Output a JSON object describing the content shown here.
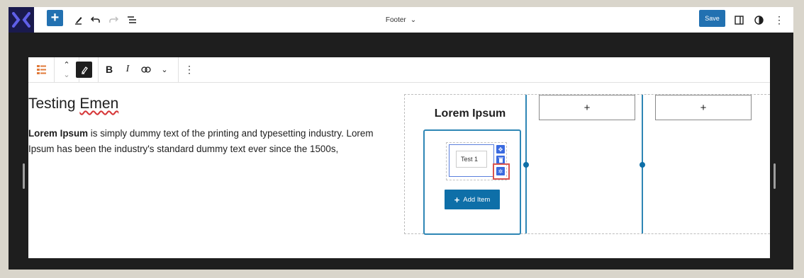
{
  "colors": {
    "accent": "#2271b1",
    "column_border": "#2e86b5",
    "add_item_button": "#0e6fa8",
    "highlight": "#d9534f",
    "logo_bg": "#1a1a4e",
    "logo_fg": "#5f5fe8"
  },
  "topbar": {
    "template_title": "Footer",
    "save_label": "Save",
    "icons": [
      "logo-icon",
      "plus-icon",
      "pencil-icon",
      "undo-icon",
      "redo-icon",
      "list-view-icon",
      "chevron-down-icon",
      "sidebar-toggle-icon",
      "styles-icon",
      "options-icon"
    ]
  },
  "block_toolbar": {
    "icons": [
      "list-block-icon",
      "move-up-icon",
      "move-down-icon",
      "highlight-icon",
      "bold-icon",
      "italic-icon",
      "link-icon",
      "more-rich-text-icon",
      "block-options-icon"
    ],
    "bold": "B",
    "italic": "I"
  },
  "content": {
    "heading_first": "Testing",
    "heading_second": "Emen",
    "para_bold": "Lorem Ipsum",
    "para_rest": " is simply dummy text of the printing and typesetting industry. Lorem Ipsum has been the industry's standard dummy text ever since the 1500s,"
  },
  "columns": {
    "title": "Lorem Ipsum",
    "test_item": "Test 1",
    "add_item_label": "Add Item",
    "placeholder_symbol": "+"
  }
}
